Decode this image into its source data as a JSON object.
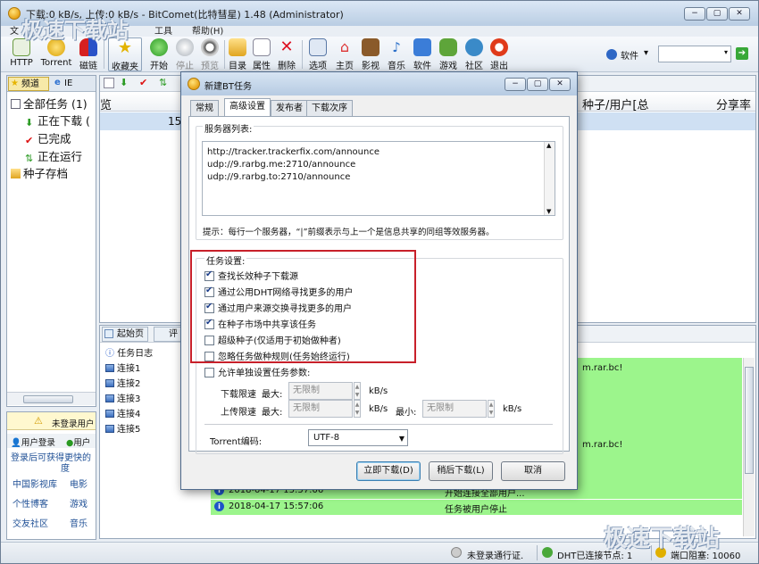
{
  "window": {
    "title": "下载:0 kB/s, 上传:0 kB/s - BitComet(比特彗星) 1.48 (Administrator)",
    "controls": [
      "−",
      "▢",
      "✕"
    ]
  },
  "menu": {
    "items": [
      "文",
      "工具",
      "帮助(H)"
    ]
  },
  "toolbar": {
    "buttons": [
      "HTTP",
      "Torrent",
      "磁链",
      "收藏夹",
      "开始",
      "停止",
      "预览",
      "目录",
      "属性",
      "删除",
      "选项",
      "主页",
      "影视",
      "音乐",
      "软件",
      "游戏",
      "社区",
      "退出"
    ],
    "soft_label": "软件",
    "soft_arrow": "▾"
  },
  "left_panel": {
    "tabs": [
      "频道",
      "IE"
    ],
    "tree": [
      "全部任务 (1)",
      "正在下载 (",
      "已完成",
      "正在运行",
      "种子存档"
    ]
  },
  "left_lower": {
    "header": "未登录用户",
    "login_tabs": [
      "用户登录",
      "用户"
    ],
    "promo_line1": "登录后可获得更快的",
    "promo_line2": "度",
    "links": [
      [
        "中国影视库",
        "电影"
      ],
      [
        "个性博客",
        "游戏"
      ],
      [
        "交友社区",
        "音乐"
      ]
    ]
  },
  "right_panel": {
    "header_left": "览",
    "header_col1": "种子/用户[总",
    "header_col2": "分享率",
    "row_value": "15"
  },
  "right_lower": {
    "tabs": [
      "起始页",
      "评"
    ],
    "tree": [
      "任务日志",
      "连接1",
      "连接2",
      "连接3",
      "连接4",
      "连接5"
    ],
    "log_partial": [
      "m.rar.bc!",
      "m.rar.bc!"
    ],
    "log_rows": [
      {
        "time": "2018-04-17 15:57:06",
        "msg": "开始连接全部用户..."
      },
      {
        "time": "2018-04-17 15:57:06",
        "msg": "任务被用户停止"
      }
    ]
  },
  "status_bar": {
    "login": "未登录通行证.",
    "dht": "DHT已连接节点: 1",
    "port": "端口阻塞: 10060"
  },
  "watermarks": [
    "极速下载站",
    "极速下载站"
  ],
  "dialog": {
    "title": "新建BT任务",
    "controls": [
      "−",
      "▢",
      "✕"
    ],
    "tabs": [
      "常规",
      "高级设置",
      "发布者",
      "下载次序"
    ],
    "tracker_label": "服务器列表:",
    "trackers": [
      "http://tracker.trackerfix.com/announce",
      "udp://9.rarbg.me:2710/announce",
      "udp://9.rarbg.to:2710/announce"
    ],
    "tip": "提示：每行一个服务器，“|”前缀表示与上一个是信息共享的同组等效服务器。",
    "task_settings_label": "任务设置:",
    "options": [
      {
        "label": "查找长效种子下载源",
        "checked": true
      },
      {
        "label": "通过公用DHT网络寻找更多的用户",
        "checked": true
      },
      {
        "label": "通过用户来源交换寻找更多的用户",
        "checked": true
      },
      {
        "label": "在种子市场中共享该任务",
        "checked": true
      },
      {
        "label": "超级种子(仅适用于初始做种者)",
        "checked": false
      },
      {
        "label": "忽略任务做种规则(任务始终运行)",
        "checked": false
      }
    ],
    "individual_label": "允许单独设置任务参数:",
    "download_limit_label": "下载限速",
    "upload_limit_label": "上传限速",
    "max_label": "最大:",
    "min_label": "最小:",
    "unlimited": "无限制",
    "unit": "kB/s",
    "encoding_label": "Torrent编码:",
    "encoding_value": "UTF-8",
    "buttons": {
      "now": "立即下载(D)",
      "later": "稍后下载(L)",
      "cancel": "取消"
    }
  },
  "colors": {
    "log_green": "#9cf58c",
    "highlight_red": "#c8202a",
    "selection_blue": "#cfe0f3"
  }
}
